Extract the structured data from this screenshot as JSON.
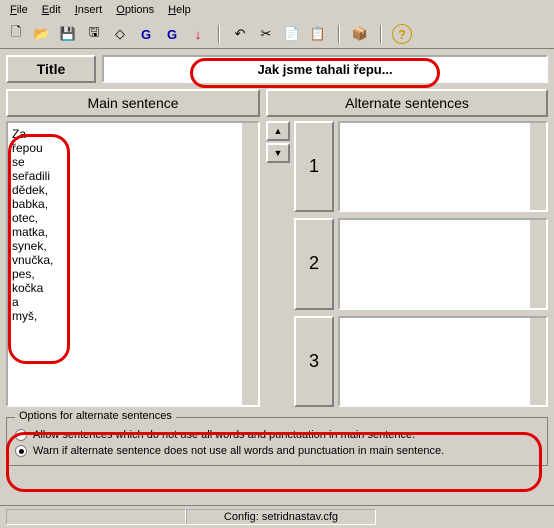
{
  "menu": {
    "file": "File",
    "edit": "Edit",
    "insert": "Insert",
    "options": "Options",
    "help": "Help"
  },
  "toolbar": {
    "new": "🗋",
    "open": "📂",
    "save": "💾",
    "saveset": "🖫",
    "erase": "◇",
    "g1": "G",
    "g2": "G",
    "down": "↓",
    "undo": "↶",
    "cut": "✂",
    "copy": "📄",
    "paste": "📋",
    "app": "📦",
    "help": "?"
  },
  "title": {
    "label": "Title",
    "value": "Jak jsme tahali řepu..."
  },
  "cols": {
    "main": "Main sentence",
    "alt": "Alternate sentences"
  },
  "main_text": "Za\nřepou\nse\nseřadili\ndědek,\nbabka,\notec,\nmatka,\nsynek,\nvnučka,\npes,\nkočka\na\nmyš,",
  "arrows": {
    "up": "▲",
    "down": "▼"
  },
  "nums": {
    "n1": "1",
    "n2": "2",
    "n3": "3"
  },
  "options": {
    "legend": "Options for alternate sentences",
    "opt1": "Allow sentences which do not use all words and punctuation in main sentence.",
    "opt2": "Warn if alternate sentence does not use all words and punctuation in main sentence."
  },
  "status": {
    "config": "Config: setridnastav.cfg"
  }
}
